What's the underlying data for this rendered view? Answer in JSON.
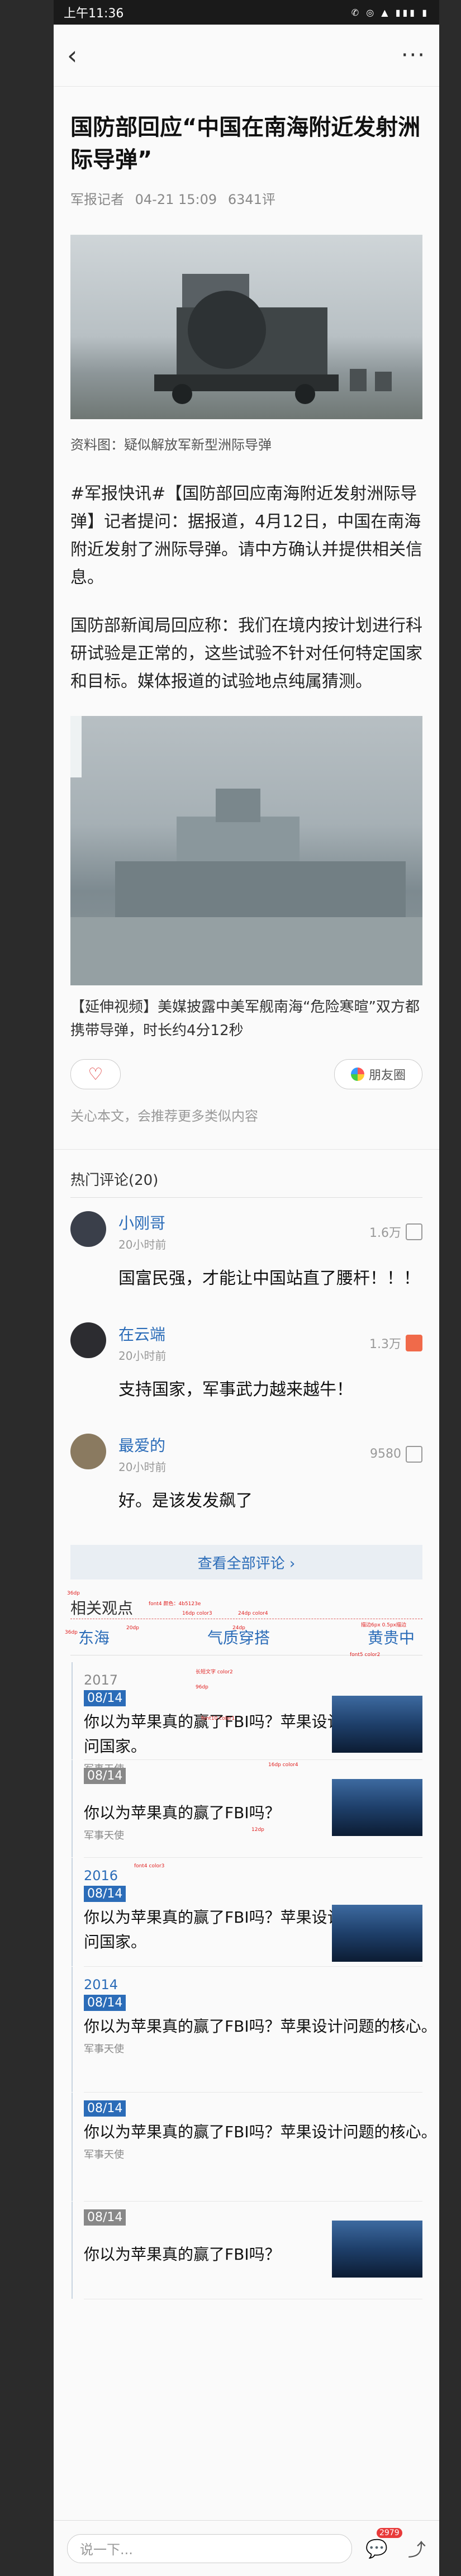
{
  "status": {
    "time": "上午11:36",
    "icons": "✆ ◎ ▲ ▮▮▮ ▮"
  },
  "nav": {
    "back": "‹",
    "more": "···"
  },
  "article": {
    "title": "国防部回应“中国在南海附近发射洲际导弹”",
    "source": "军报记者",
    "date": "04-21 15:09",
    "comment_count": "6341评",
    "caption1": "资料图：疑似解放军新型洲际导弹",
    "para1": "#军报快讯#【国防部回应南海附近发射洲际导弹】记者提问：据报道，4月12日，中国在南海附近发射了洲际导弹。请中方确认并提供相关信息。",
    "para2": "国防部新闻局回应称：我们在境内按计划进行科研试验是正常的，这些试验不针对任何特定国家和目标。媒体报道的试验地点纯属猜测。",
    "video_caption": "【延伸视频】美媒披露中美军舰南海“危险寒暄”双方都携带导弹，时长约4分12秒",
    "share_label": "朋友圈",
    "follow_text": "关心本文，会推荐更多类似内容"
  },
  "comments_header": "热门评论(20)",
  "comments": [
    {
      "name": "小刚哥",
      "time": "20小时前",
      "likes": "1.6万",
      "text": "国富民强，才能让中国站直了腰杆！！！"
    },
    {
      "name": "在云端",
      "time": "20小时前",
      "likes": "1.3万",
      "text": "支持国家，军事武力越来越牛！"
    },
    {
      "name": "最爱的",
      "time": "20小时前",
      "likes": "9580",
      "text": "好。是该发发飙了"
    }
  ],
  "view_all": "查看全部评论 ›",
  "spec": {
    "view_title": "相关观点",
    "tags": [
      "东海",
      "气质穿搭",
      "黄贵中"
    ],
    "annotations": [
      "36dp",
      "font4 颜色：4b5123e",
      "16dp color3",
      "36dp",
      "24dp color4",
      "20dp",
      "24dp",
      "描边6px 0.5px描边",
      "font5 color2",
      "14dp",
      "10dp",
      "12dp",
      "36dp",
      "font2 color4",
      "长短文字 color2",
      "10dp",
      "10dp",
      "10dp",
      "10dp",
      "12dp",
      "10dp",
      "12dp",
      "156dp",
      "96dp",
      "font10 color1",
      "16dp",
      "12dp",
      "font3 color3",
      "16dp",
      "16dp",
      "16dp color4",
      "20dp",
      "12dp",
      "9dp",
      "12dp",
      "16dp",
      "16dp",
      "font4 color3"
    ],
    "items": [
      {
        "year": "2017",
        "date": "08/14",
        "title": "你以为苹果真的赢了FBI吗？苹果设计问国家。",
        "source": "军事天使",
        "thumb": true
      },
      {
        "year": "",
        "date": "08/14",
        "title": "你以为苹果真的赢了FBI吗？",
        "source": "军事天使",
        "thumb": true
      },
      {
        "year": "2016",
        "date": "08/14",
        "title": "你以为苹果真的赢了FBI吗？苹果设计问国家。",
        "source": "",
        "thumb": true
      },
      {
        "year": "2014",
        "date": "08/14",
        "title": "你以为苹果真的赢了FBI吗？苹果设计问题的核心。",
        "source": "军事天使",
        "thumb": false
      },
      {
        "year": "",
        "date": "08/14",
        "title": "你以为苹果真的赢了FBI吗？苹果设计问题的核心。",
        "source": "军事天使",
        "thumb": false
      },
      {
        "year": "",
        "date": "08/14",
        "title": "你以为苹果真的赢了FBI吗？",
        "source": "",
        "thumb": true
      }
    ]
  },
  "bottom": {
    "placeholder": "说一下...",
    "badge": "2979"
  }
}
